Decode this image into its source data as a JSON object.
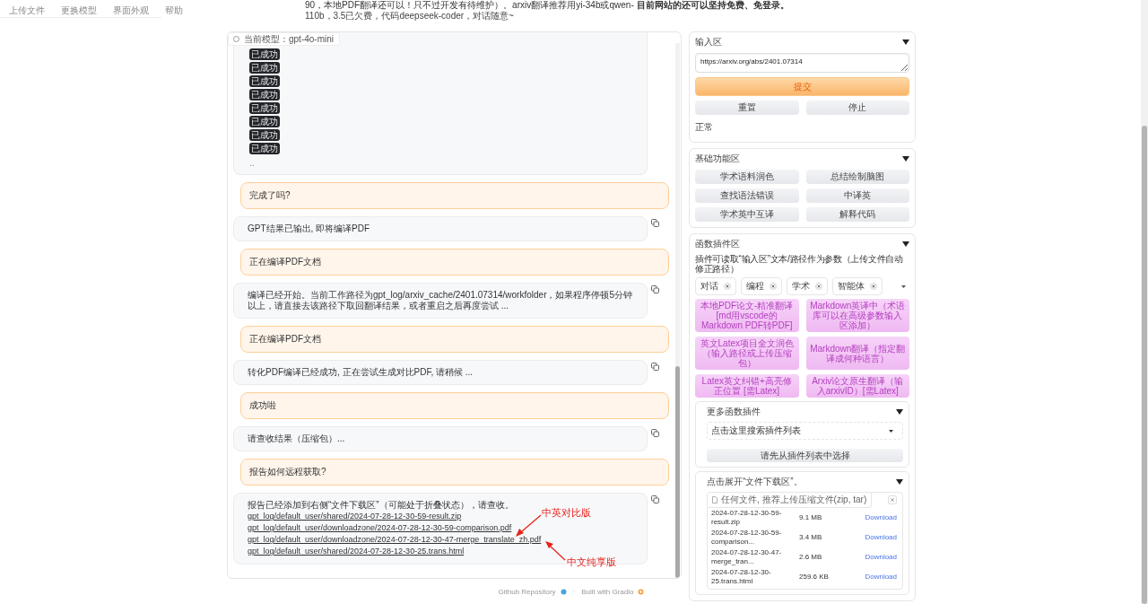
{
  "nav_tabs": [
    {
      "label": "上传文件"
    },
    {
      "label": "更换模型"
    },
    {
      "label": "界面外观"
    },
    {
      "label": "帮助"
    }
  ],
  "notice": [
    "90，本地PDF翻译还可以！只不过开发有待维护）。arxiv翻译推荐用yi-34b或qwen- **目前网站的还可以坚持免费、免登录。**",
    "110b，3.5已欠费，代码deepseek-coder，对话随意~"
  ],
  "chat": {
    "model_label": "当前模型：gpt-4o-mini",
    "messages": [
      {
        "kind": "status",
        "badges": [
          "已成功",
          "已成功",
          "已成功",
          "已成功",
          "已成功",
          "已成功",
          "已成功",
          "已成功"
        ],
        "text": ".."
      },
      {
        "kind": "question",
        "text": "完成了吗?"
      },
      {
        "kind": "reply",
        "text": "GPT结果已输出, 即将编译PDF"
      },
      {
        "kind": "question",
        "text": "正在编译PDF文档"
      },
      {
        "kind": "reply",
        "text": "编译已经开始。当前工作路径为gpt_log/arxiv_cache/2401.07314/workfolder，如果程序停顿5分钟以上，请直接去该路径下取回翻译结果，或者重启之后再度尝试 ..."
      },
      {
        "kind": "question",
        "text": "正在编译PDF文档"
      },
      {
        "kind": "reply",
        "text": "转化PDF编译已经成功, 正在尝试生成对比PDF, 请稍候 ..."
      },
      {
        "kind": "question",
        "text": "成功啦"
      },
      {
        "kind": "reply",
        "text": "请查收结果（压缩包）..."
      },
      {
        "kind": "question",
        "text": "报告如何远程获取?"
      },
      {
        "kind": "files",
        "text": "报告已经添加到右侧“文件下载区”（可能处于折叠状态），请查收。",
        "links": [
          "gpt_log/default_user/shared/2024-07-28-12-30-59-result.zip",
          "gpt_log/default_user/downloadzone/2024-07-28-12-30-59-comparison.pdf",
          "gpt_log/default_user/downloadzone/2024-07-28-12-30-47-merge_translate_zh.pdf",
          "gpt_log/default_user/shared/2024-07-28-12-30-25.trans.html"
        ]
      }
    ],
    "annotations": [
      {
        "text": "中英对比版"
      },
      {
        "text": "中文纯享版"
      }
    ]
  },
  "input_panel": {
    "title": "输入区",
    "value": "https://arxiv.org/abs/2401.07314",
    "submit": "提交",
    "buttons": [
      "重置",
      "停止"
    ],
    "status": "正常"
  },
  "basic_panel": {
    "title": "基础功能区",
    "buttons": [
      "学术语料润色",
      "总结绘制脑图",
      "查找语法错误",
      "中译英",
      "学术英中互译",
      "解释代码"
    ]
  },
  "plugin_panel": {
    "title": "函数插件区",
    "hint": "插件可读取“输入区”文本/路径作为参数（上传文件自动修正路径）",
    "tags": [
      "对话",
      "编程",
      "学术",
      "智能体"
    ],
    "buttons": [
      "本地PDF论文-精准翻译[md用vscode的Markdown PDF转PDF]",
      "Markdown英译中（术语库可以在高级参数输入区添加）",
      "英文Latex项目全文润色（输入路径或上传压缩包）",
      "Markdown翻译（指定翻译成何种语言）",
      "Latex英文纠错+高亮修正位置 [需Latex]",
      "Arxiv论文原生翻译（输入arxivID）[需Latex]"
    ],
    "more": {
      "title": "更多函数插件",
      "dropdown_value": "点击这里搜索插件列表",
      "button": "请先从插件列表中选择"
    },
    "downloads": {
      "title": "点击展开“文件下载区”。",
      "dropzone_hint": "任何文件, 推荐上传压缩文件(zip, tar)",
      "files": [
        {
          "name": "2024-07-28-12-30-59-result.zip",
          "size": "9.1 MB",
          "link": "Download"
        },
        {
          "name": "2024-07-28-12-30-59-comparison...",
          "size": "3.4 MB",
          "link": "Download"
        },
        {
          "name": "2024-07-28-12-30-47-merge_tran...",
          "size": "2.6 MB",
          "link": "Download"
        },
        {
          "name": "2024-07-28-12-30-25.trans.html",
          "size": "259.6 KB",
          "link": "Download"
        }
      ]
    }
  },
  "footer": {
    "links": [
      "Github Repository",
      "Built with Gradio"
    ],
    "separator": "·"
  }
}
